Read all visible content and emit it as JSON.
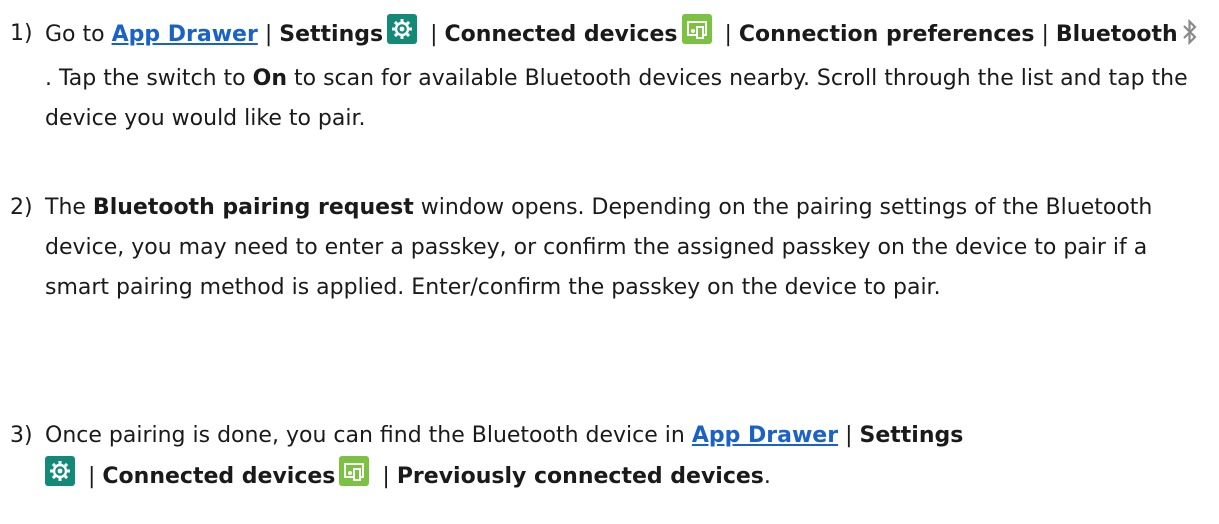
{
  "steps": [
    {
      "number": "1)",
      "parts": {
        "go_to": "Go to ",
        "app_drawer": "App Drawer",
        "sep1": " | ",
        "settings": "Settings",
        "sep2": " | ",
        "connected_devices": "Connected devices",
        "sep3": " | ",
        "connection_preferences": "Connection preferences",
        "sep4": " | ",
        "bluetooth": "Bluetooth",
        "after_bt": ". Tap the switch to ",
        "on": "On",
        "rest": " to scan for available Bluetooth devices nearby. Scroll through the list and tap the device you would like to pair."
      }
    },
    {
      "number": "2)",
      "parts": {
        "the": "The ",
        "pairing_request": "Bluetooth pairing request",
        "rest": " window opens. Depending on the pairing settings of the Bluetooth device, you may need to enter a passkey, or confirm the assigned passkey on the device to pair if a smart pairing method is applied. Enter/confirm the passkey on the device to pair."
      }
    },
    {
      "number": "3)",
      "parts": {
        "lead": "Once pairing is done, you can find the Bluetooth device in ",
        "app_drawer": "App Drawer",
        "sep1": " | ",
        "settings": "Settings",
        "sep2": " | ",
        "connected_devices": "Connected devices",
        "sep3": " | ",
        "previously": "Previously connected devices",
        "end": "."
      }
    }
  ],
  "icons": {
    "settings": "settings-gear-icon",
    "connected_devices": "connected-devices-icon",
    "bluetooth": "bluetooth-icon"
  },
  "colors": {
    "link": "#1a62c8",
    "settings_icon_bg": "#138a78",
    "devices_icon_bg": "#7cc242",
    "text": "#1a1a1a"
  }
}
